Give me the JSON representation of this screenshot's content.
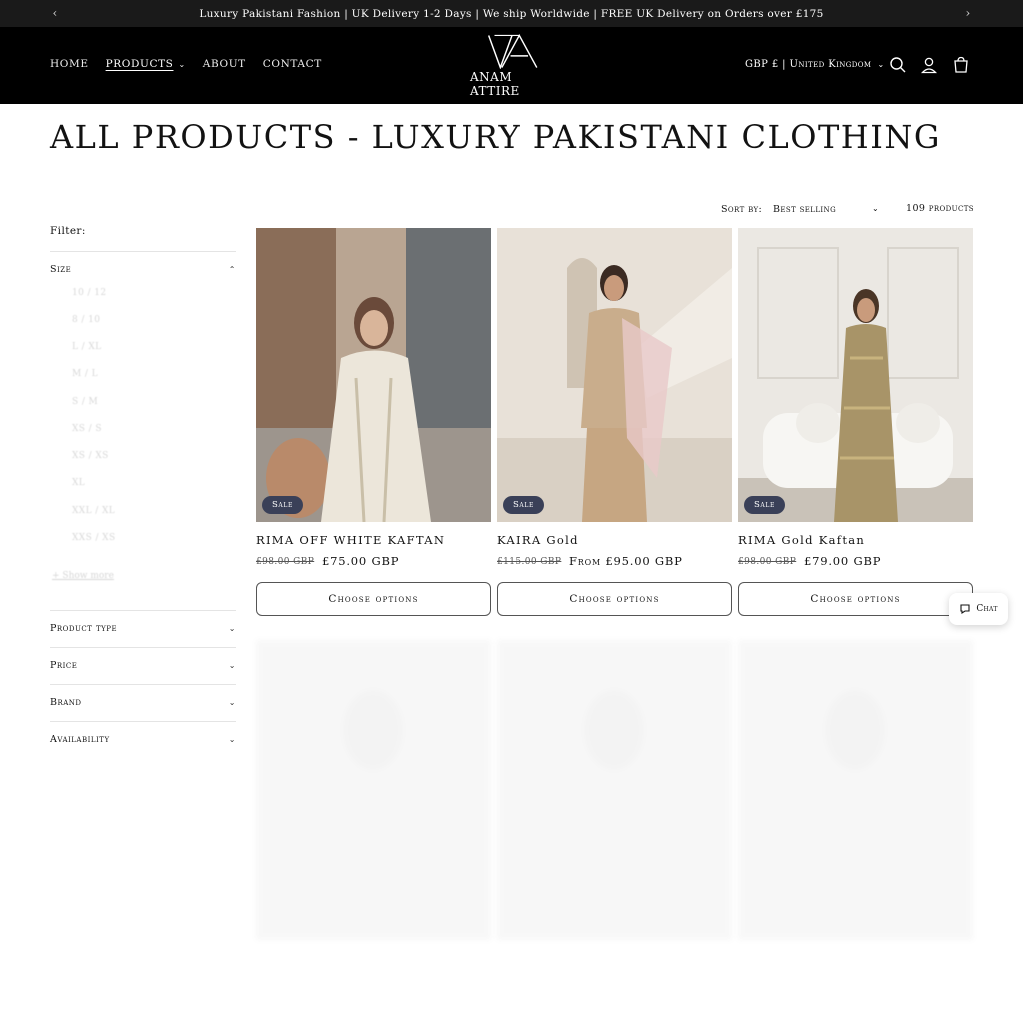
{
  "announcement": {
    "text": "Luxury Pakistani Fashion | UK Delivery 1-2 Days | We ship Worldwide | FREE UK Delivery on Orders over £175",
    "prev_icon": "chevron-left-icon",
    "next_icon": "chevron-right-icon"
  },
  "header": {
    "nav": [
      {
        "label": "HOME"
      },
      {
        "label": "PRODUCTS",
        "active": true,
        "has_dropdown": true
      },
      {
        "label": "ABOUT"
      },
      {
        "label": "CONTACT"
      }
    ],
    "logo_text": "ANAM ATTIRE",
    "locale": "GBP £ | United Kingdom",
    "icons": [
      "search-icon",
      "account-icon",
      "cart-icon"
    ]
  },
  "page": {
    "title": "ALL PRODUCTS - LUXURY PAKISTANI CLOTHING"
  },
  "filters": {
    "label": "Filter:",
    "size": {
      "label": "Size",
      "options": [
        "10 / 12",
        "8 / 10",
        "L / XL",
        "M / L",
        "S / M",
        "XS / S",
        "XS / XS",
        "XL",
        "XXL / XL",
        "XXS / XS"
      ],
      "show_more": "+ Show more"
    },
    "facets": [
      "Product type",
      "Price",
      "Brand",
      "Availability"
    ]
  },
  "sort": {
    "label": "Sort by:",
    "value": "Best selling",
    "count": "109 products"
  },
  "products": [
    {
      "title": "RIMA OFF WHITE KAFTAN",
      "compare": "£98.00 GBP",
      "price": "£75.00 GBP",
      "badge": "Sale",
      "button": "Choose options"
    },
    {
      "title": "KAIRA Gold",
      "compare": "£115.00 GBP",
      "price": "From £95.00 GBP",
      "badge": "Sale",
      "button": "Choose options"
    },
    {
      "title": "RIMA Gold Kaftan",
      "compare": "£98.00 GBP",
      "price": "£79.00 GBP",
      "badge": "Sale",
      "button": "Choose options"
    }
  ],
  "chat": {
    "label": "Chat",
    "icon": "chat-icon"
  },
  "colors": {
    "header_bg": "#000000",
    "announce_bg": "#1a1a1a",
    "badge_bg": "#3a4058"
  }
}
